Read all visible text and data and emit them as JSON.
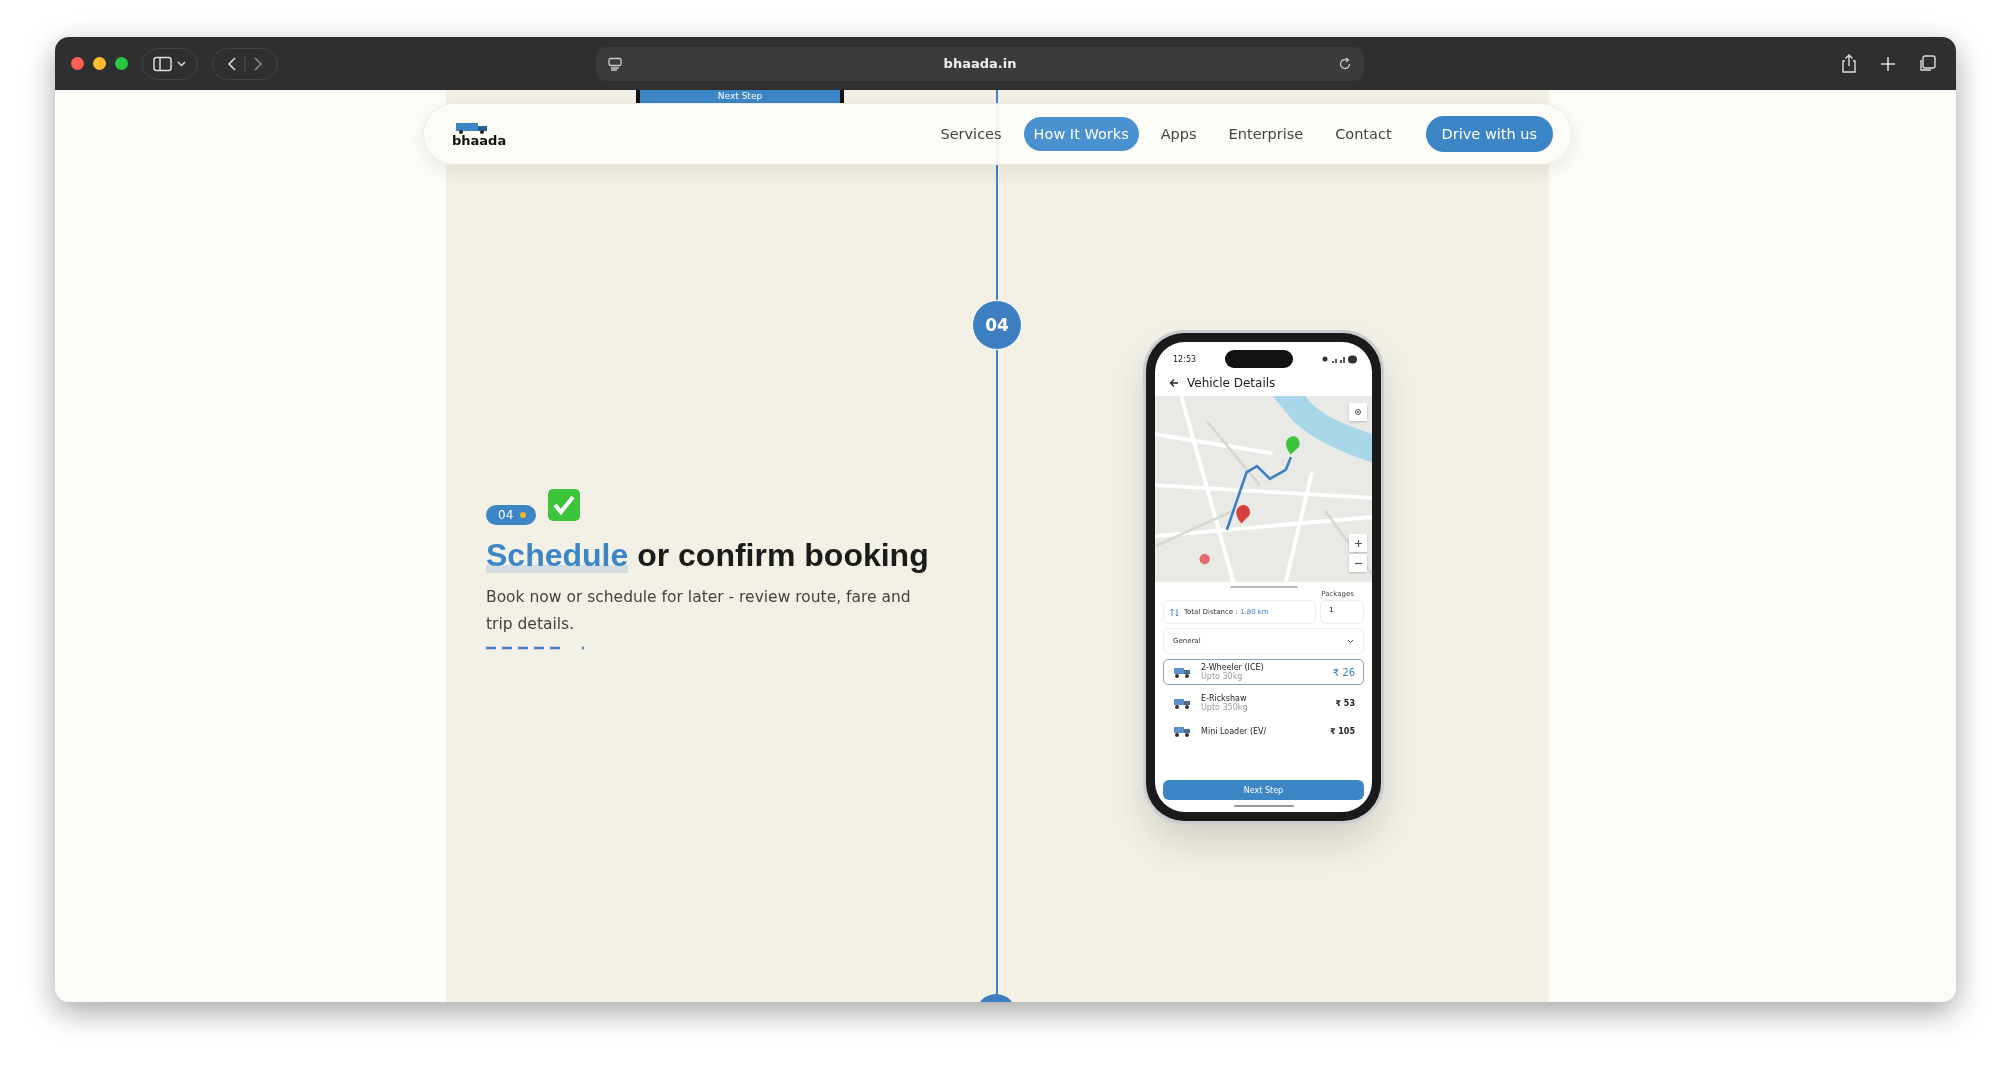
{
  "browser": {
    "url": "bhaada.in"
  },
  "previous_step": {
    "button": "Next Step"
  },
  "nav": {
    "logo": "bhaada",
    "items": [
      {
        "label": "Services",
        "selected": false
      },
      {
        "label": "How It Works",
        "selected": true
      },
      {
        "label": "Apps",
        "selected": false
      },
      {
        "label": "Enterprise",
        "selected": false
      },
      {
        "label": "Contact",
        "selected": false
      }
    ],
    "cta": "Drive with us"
  },
  "timeline": {
    "step_number": "04"
  },
  "step": {
    "badge": "04",
    "done": true,
    "title_highlight": "Schedule",
    "title_rest": "or confirm booking",
    "description": "Book now or schedule for later - review route, fare and trip details."
  },
  "phone": {
    "time": "12:53",
    "screen_title": "Vehicle Details",
    "packages_label": "Packages",
    "distance_label": "Total Distance :",
    "distance_value": "1.80 km",
    "packages_value": "1",
    "category": "General",
    "vehicles": [
      {
        "name": "2-Wheeler (ICE)",
        "capacity": "Upto 30kg",
        "price": "₹ 26",
        "selected": true
      },
      {
        "name": "E-Rickshaw",
        "capacity": "Upto 350kg",
        "price": "₹ 53",
        "selected": false
      },
      {
        "name": "Mini Loader (EV/",
        "price": "₹ 105",
        "selected": false
      }
    ],
    "button": "Next Step"
  }
}
